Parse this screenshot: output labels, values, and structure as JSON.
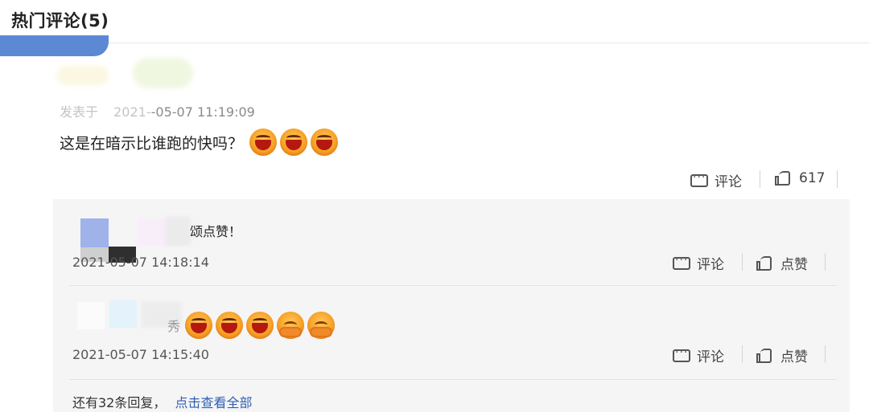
{
  "header": {
    "title": "热门评论(5)"
  },
  "main_comment": {
    "meta_label": "发表于",
    "meta_fragment_visible": "2021-",
    "timestamp_visible": "-05-07 11:19:09",
    "text": "这是在暗示比谁跑的快吗？",
    "emojis": [
      "laugh-emoji",
      "laugh-emoji",
      "laugh-emoji"
    ],
    "actions": {
      "comment_label": "评论",
      "like_count": "617"
    }
  },
  "replies": [
    {
      "text_visible": "颂点赞！",
      "timestamp": "2021-05-07 14:18:14",
      "actions": {
        "comment_label": "评论",
        "like_label": "点赞"
      }
    },
    {
      "text_visible": "秀",
      "emojis": [
        "laugh-emoji",
        "laugh-emoji",
        "laugh-emoji",
        "hug-emoji",
        "hug-emoji"
      ],
      "timestamp": "2021-05-07 14:15:40",
      "actions": {
        "comment_label": "评论",
        "like_label": "点赞"
      }
    }
  ],
  "more_replies": {
    "text": "还有32条回复，",
    "link_label": "点击查看全部"
  },
  "colors": {
    "accent_link": "#2f5fb3",
    "title_stripe": "#4d7fd0",
    "reply_bg": "#f5f5f6"
  }
}
